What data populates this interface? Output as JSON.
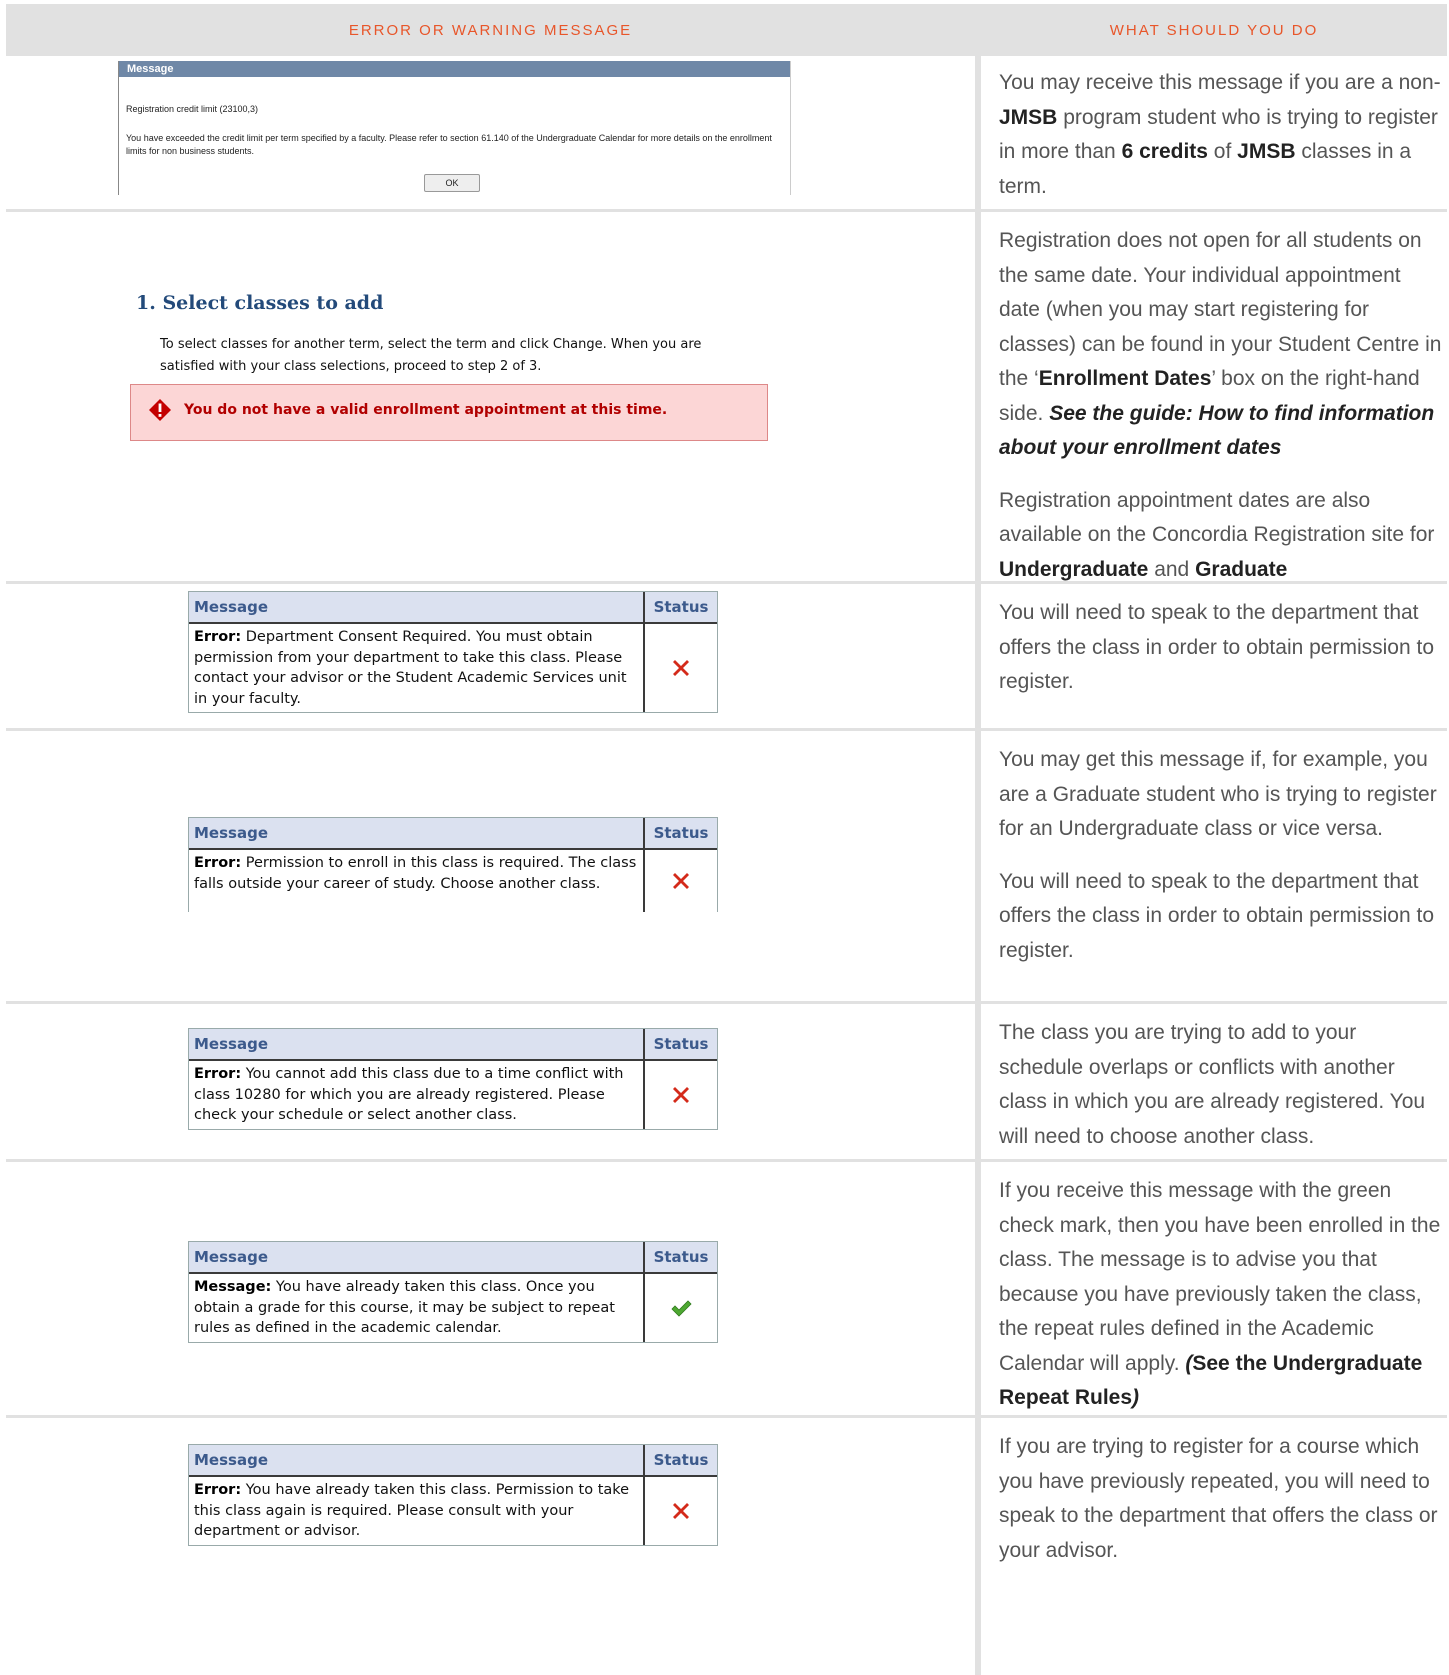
{
  "header": {
    "left": "ERROR OR WARNING MESSAGE",
    "right": "WHAT SHOULD YOU DO"
  },
  "rows": [
    {
      "dialog": {
        "title": "Message",
        "line1": "Registration credit limit (23100,3)",
        "line2": "You have exceeded the credit limit per term specified by a faculty. Please refer to section 61.140 of the Undergraduate Calendar for more details on the enrollment limits for non business students.",
        "ok": "OK"
      },
      "right": {
        "t1": "You may receive this message if you are a non-",
        "b1": "JMSB",
        "t2": " program student who is trying to register in more than ",
        "b2": "6 credits",
        "t3": " of ",
        "b3": "JMSB",
        "t4": " classes in a term."
      }
    },
    {
      "heading": "1.  Select classes to add",
      "desc": "To select classes for another term, select the term and click Change.  When you are satisfied with your class selections, proceed to step 2 of 3.",
      "alert": "You do not have a valid enrollment appointment at this time.",
      "right": {
        "p1_t1": "Registration does not open for all students on the same date. Your individual appointment date (when you may start registering for classes) can be found in your Student Centre in the ‘",
        "p1_b1": "Enrollment Dates",
        "p1_t2": "’ box on the right-hand side. ",
        "p1_i1": "See the guide: How to find information about your enrollment dates",
        "p2_t1": "Registration appointment dates are also available on the Concordia Registration site for ",
        "p2_b1": "Undergraduate",
        "p2_t2": " and ",
        "p2_b2": "Graduate"
      }
    },
    {
      "col_message": "Message",
      "col_status": "Status",
      "label": "Error:",
      "text": " Department Consent Required. You must obtain permission from your department to take this class. Please contact your advisor or the Student Academic Services unit in your faculty.",
      "status_icon": "red-x-icon",
      "right": "You will need to speak to the department that offers the class in order to obtain permission to register."
    },
    {
      "col_message": "Message",
      "col_status": "Status",
      "label": "Error:",
      "text": " Permission to enroll in this class is required. The class falls outside your career of study. Choose another class.",
      "status_icon": "red-x-icon",
      "right_p1": "You may get this message if, for example, you are a Graduate student who is trying to register for an Undergraduate class or vice versa.",
      "right_p2": "You will need to speak to the department that offers the class in order to obtain permission to register."
    },
    {
      "col_message": "Message",
      "col_status": "Status",
      "label": "Error:",
      "text": " You cannot add this class due to a time conflict with class 10280 for which you are already registered. Please check your schedule or select another class.",
      "status_icon": "red-x-icon",
      "right": "The class you are trying to add to your schedule overlaps or conflicts with another class in which you are already registered. You will need to choose another class."
    },
    {
      "col_message": "Message",
      "col_status": "Status",
      "label": "Message:",
      "text": " You have already taken this class. Once you obtain a grade for this course, it may be subject to repeat rules as defined in the academic calendar.",
      "status_icon": "green-check-icon",
      "right": {
        "t1": "If you receive this message with the green check mark, then you have been enrolled in the class. The message is to advise you that because you have previously taken the class, the repeat rules defined in the Academic Calendar will apply. ",
        "i1": "(",
        "b1": "See the Undergraduate Repeat Rules",
        "i2": ")"
      }
    },
    {
      "col_message": "Message",
      "col_status": "Status",
      "label": "Error:",
      "text": " You have already taken this class. Permission to take this class again is required. Please consult with your department or advisor.",
      "status_icon": "red-x-icon",
      "right": "If you are trying to register for a course which you have previously repeated, you will need to speak to the department that offers the class or your advisor."
    }
  ],
  "colors": {
    "header_text": "#e8562a",
    "header_bg": "#e1e1e1",
    "alert_bg": "#fcd6d6",
    "alert_text": "#b10000"
  }
}
